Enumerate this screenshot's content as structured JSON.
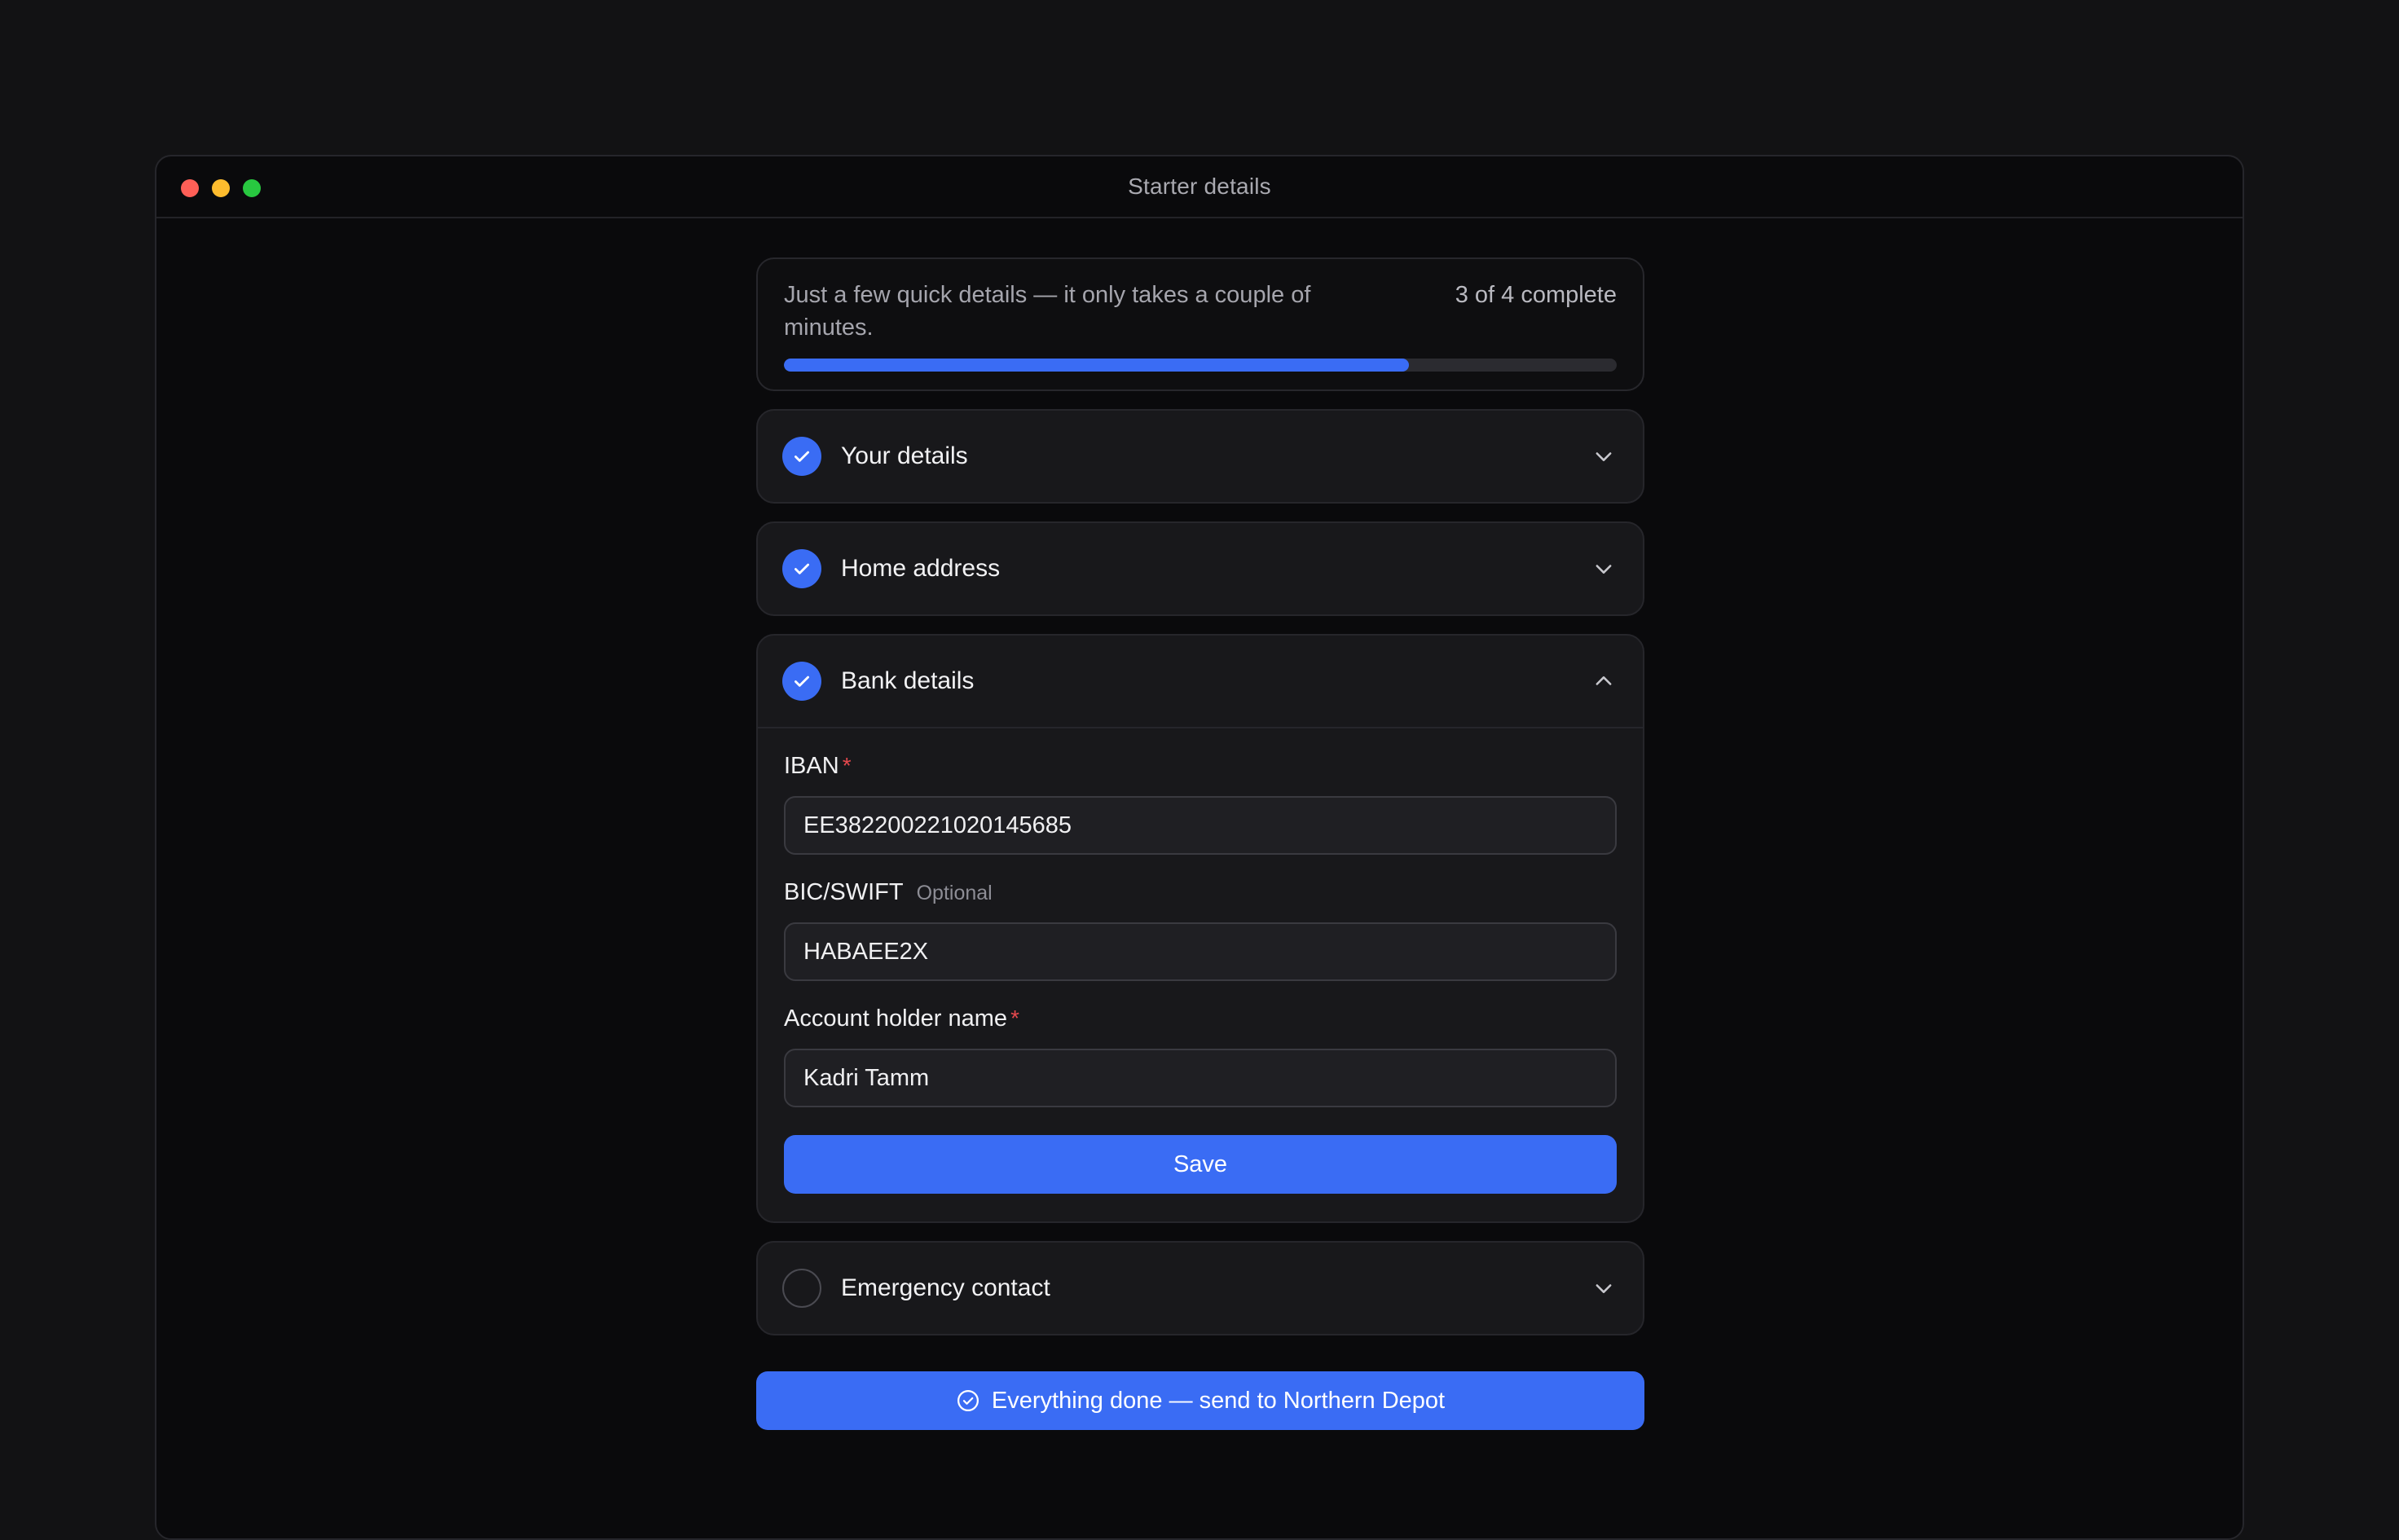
{
  "window": {
    "title": "Starter details",
    "controls": [
      {
        "name": "close",
        "color": "#ff5f57"
      },
      {
        "name": "minimize",
        "color": "#febc2e"
      },
      {
        "name": "maximize",
        "color": "#28c840"
      }
    ]
  },
  "progress": {
    "message": "Just a few quick details — it only takes a couple of minutes.",
    "count_label": "3 of 4 complete",
    "completed": 3,
    "total": 4,
    "fraction": 0.75
  },
  "sections": [
    {
      "title": "Your details",
      "status": "complete",
      "expanded": false,
      "status_icon": "check-icon",
      "toggle_icon": "chevron-down-icon"
    },
    {
      "title": "Home address",
      "status": "complete",
      "expanded": false,
      "status_icon": "check-icon",
      "toggle_icon": "chevron-down-icon"
    },
    {
      "title": "Bank details",
      "status": "complete",
      "expanded": true,
      "status_icon": "check-icon",
      "toggle_icon": "chevron-up-icon"
    },
    {
      "title": "Emergency contact",
      "status": "incomplete",
      "expanded": false,
      "status_icon": "empty-circle-icon",
      "toggle_icon": "chevron-down-icon"
    }
  ],
  "bank_form": {
    "iban": {
      "label": "IBAN",
      "required_marker": "*",
      "value": "EE382200221020145685"
    },
    "bic": {
      "label": "BIC/SWIFT",
      "optional_label": "Optional",
      "value": "HABAEE2X"
    },
    "holder": {
      "label": "Account holder name",
      "required_marker": "*",
      "value": "Kadri Tamm"
    },
    "save_label": "Save"
  },
  "submit": {
    "label": "Everything done — send to Northern Depot",
    "icon": "check-circle-icon"
  },
  "colors": {
    "accent": "#3a6cf4",
    "required": "#e5484d"
  }
}
